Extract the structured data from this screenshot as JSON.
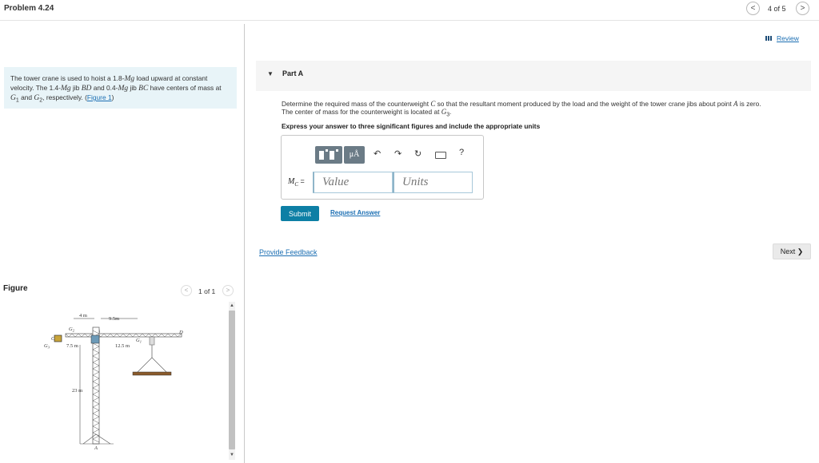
{
  "header": {
    "title": "Problem 4.24",
    "prev_symbol": "<",
    "pager": "4 of 5",
    "next_symbol": ">"
  },
  "intro": {
    "part1": "The tower crane is used to hoist a 1.8-",
    "unit1": "Mg",
    "part2": " load upward at constant velocity. The 1.4-",
    "unit2": "Mg",
    "part3": " jib ",
    "jib1": "BD",
    "part4": " and 0.4-",
    "unit3": "Mg",
    "part5": " jib ",
    "jib2": "BC",
    "part6": " have centers of mass at ",
    "g1": "G",
    "g1sub": "1",
    "part7": " and ",
    "g2": "G",
    "g2sub": "2",
    "part8": ", respectively. (",
    "figure_link": "Figure 1",
    "part9": ")"
  },
  "figure": {
    "label": "Figure",
    "prev_symbol": "<",
    "pager": "1 of 1",
    "next_symbol": ">",
    "labels": {
      "d4m": "4 m",
      "d95m": "9.5m",
      "g2": "G",
      "g2sub": "2",
      "b": "B",
      "d": "D",
      "c": "C",
      "g3": "G",
      "g3sub": "3",
      "d75m": "7.5 m",
      "d125m": "12.5 m",
      "g1": "G",
      "g1sub": "1",
      "d23m": "23 m",
      "a": "A"
    }
  },
  "review": {
    "label": "Review"
  },
  "part": {
    "arrow": "▼",
    "title": "Part A",
    "question1": "Determine the required mass of the counterweight ",
    "c": "C",
    "question2": " so that the resultant moment produced by the load and the weight of the tower crane jibs about point ",
    "a": "A",
    "question3": " is zero.",
    "question4": "The center of mass for the counterweight is located at ",
    "g3": "G",
    "g3sub": "3",
    "question5": ".",
    "instructions": "Express your answer to three significant figures and include the appropriate units",
    "toolbar": {
      "mu_a": "μÅ",
      "undo": "↶",
      "redo": "↷",
      "reset": "↻",
      "help": "?"
    },
    "answer": {
      "m": "M",
      "sub": "C",
      "eq": " =",
      "value_placeholder": "Value",
      "units_placeholder": "Units"
    },
    "submit": "Submit",
    "request_answer": "Request Answer"
  },
  "footer": {
    "feedback": "Provide Feedback",
    "next": "Next"
  },
  "colors": {
    "accent": "#0d7fa5",
    "link": "#1c6fb3",
    "intro_bg": "#e8f4f8"
  }
}
